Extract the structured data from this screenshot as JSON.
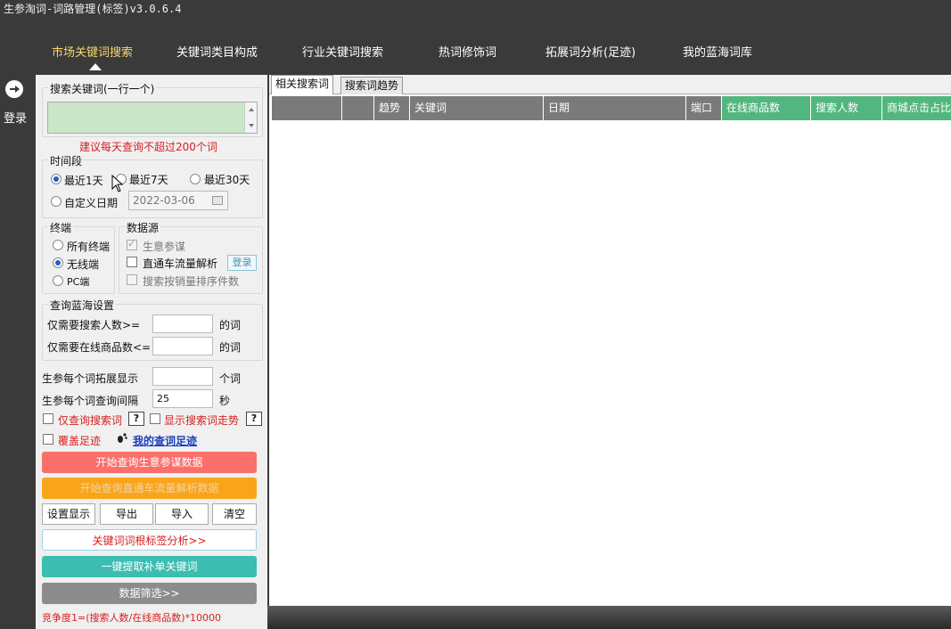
{
  "window": {
    "title": "生参淘词-词路管理(标签)v3.0.6.4"
  },
  "nav": {
    "items": [
      "市场关键词搜索",
      "关键词类目构成",
      "行业关键词搜索",
      "热词修饰词",
      "拓展词分析(足迹)",
      "我的蓝海词库"
    ],
    "active": 0
  },
  "sidebar": {
    "login_label": "登录",
    "login_icon": "arrow-right-circle-icon"
  },
  "search": {
    "group_title": "搜索关键词(一行一个)",
    "textarea_value": "",
    "hint": "建议每天查询不超过200个词"
  },
  "period": {
    "title": "时间段",
    "options": [
      "最近1天",
      "最近7天",
      "最近30天",
      "自定义日期"
    ],
    "selected": "最近1天",
    "date_value": "2022-03-06"
  },
  "terminal": {
    "title": "终端",
    "options": [
      "所有终端",
      "无线端",
      "PC端"
    ],
    "selected": "无线端"
  },
  "datasource": {
    "title": "数据源",
    "items": [
      {
        "label": "生意参谋",
        "checked": true,
        "disabled": true
      },
      {
        "label": "直通车流量解析",
        "checked": false,
        "disabled": false
      },
      {
        "label": "搜索按销量排序件数",
        "checked": false,
        "disabled": true
      }
    ],
    "login_button": "登录"
  },
  "bluesea": {
    "title": "查询蓝海设置",
    "rows": [
      {
        "label": "仅需要搜索人数>=",
        "value": "",
        "suffix": "的词"
      },
      {
        "label": "仅需要在线商品数<=",
        "value": "",
        "suffix": "的词"
      }
    ]
  },
  "settings": {
    "expand_label": "生参每个词拓展显示",
    "expand_value": "",
    "expand_suffix": "个词",
    "interval_label": "生参每个词查询间隔",
    "interval_value": "25",
    "interval_suffix": "秒"
  },
  "options": {
    "only_search_word": "仅查询搜索词",
    "show_trend": "显示搜索词走势",
    "overwrite": "覆盖足迹",
    "my_footprint": "我的查词足迹",
    "help": "?"
  },
  "actions": {
    "start_query": "开始查询生意参谋数据",
    "start_ztc": "开始查询直通车流量解析数据",
    "settings": "设置显示",
    "export": "导出",
    "import": "导入",
    "clear": "清空",
    "root_tag": "关键词词根标签分析>>",
    "extract": "一键提取补单关键词",
    "filter": "数据筛选>>"
  },
  "formula": "竞争度1=(搜索人数/在线商品数)*10000",
  "tabs": [
    "相关搜索词",
    "搜索词趋势"
  ],
  "active_tab": 0,
  "table": {
    "columns": [
      "",
      "",
      "趋势",
      "关键词",
      "日期",
      "端口",
      "在线商品数",
      "搜索人数",
      "商城点击占比"
    ],
    "green_columns": [
      6,
      7,
      8
    ],
    "rows": []
  },
  "colors": {
    "accent_nav": "#f5d76e",
    "dark_bg": "#3a3a3a",
    "green_header": "#52b77e",
    "red_button": "#fa6f6a",
    "orange_button": "#f9a51b",
    "teal_button": "#3bbdb1"
  }
}
